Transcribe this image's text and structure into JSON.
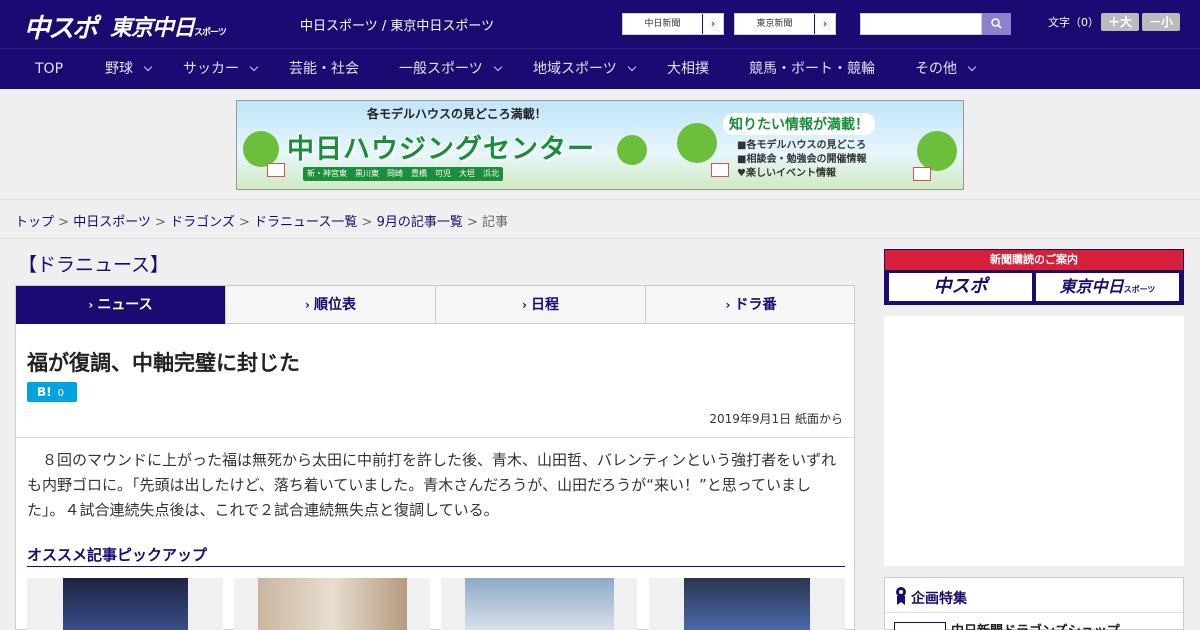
{
  "header": {
    "logo_chuspo": "中スポ",
    "logo_tokyo": "東京中日",
    "logo_tokyo_sub": "スポーツ",
    "site_title": "中日スポーツ / 東京中日スポーツ",
    "link_chunichi": "中日新聞",
    "link_tokyo": "東京新聞",
    "font_label": "文字（0）",
    "font_larger": "＋大",
    "font_smaller": "－小"
  },
  "nav": {
    "items": [
      "TOP",
      "野球",
      "サッカー",
      "芸能・社会",
      "一般スポーツ",
      "地域スポーツ",
      "大相撲",
      "競馬・ボート・競輪",
      "その他"
    ]
  },
  "banner": {
    "line1": "各モデルハウスの見どころ満載！",
    "line2": "中日ハウジングセンター",
    "line3": "知りたい情報が満載！",
    "line4a": "■各モデルハウスの見どころ",
    "line4b": "■相談会・勉強会の開催情報",
    "line4c": "♥楽しいイベント情報",
    "towns": "新・神宮東　黒川東　岡崎　豊橋　可児　大垣　浜北"
  },
  "breadcrumb": {
    "items": [
      "トップ",
      "中日スポーツ",
      "ドラゴンズ",
      "ドラニュース一覧",
      "9月の記事一覧"
    ],
    "current": "記事",
    "sep": " > "
  },
  "main": {
    "section_title": "【ドラニュース】",
    "tabs": [
      "ニュース",
      "順位表",
      "日程",
      "ドラ番"
    ],
    "headline": "福が復調、中軸完璧に封じた",
    "hatena_label": "B!",
    "hatena_count": "0",
    "pubdate": "2019年9月1日 紙面から",
    "body": "　８回のマウンドに上がった福は無死から太田に中前打を許した後、青木、山田哲、バレンティンという強打者をいずれも内野ゴロに。「先頭は出したけど、落ち着いていました。青木さんだろうが、山田だろうが“来い！”と思っていました」。４試合連続失点後は、これで２試合連続無失点と復調している。",
    "pickup_title": "オススメ記事ピックアップ"
  },
  "sidebar": {
    "subscription_head": "新聞購読のご案内",
    "sub_logo1": "中スポ",
    "sub_logo2": "東京中日",
    "sub_logo2_small": "スポーツ",
    "kikaku_title": "企画特集",
    "kikaku_item": "中日新聞ドラゴンズショップ"
  },
  "colors": {
    "brand_navy": "#1b0a72",
    "accent_red": "#d61f38",
    "hatena_blue": "#00a4de"
  },
  "icons": {
    "search": "search-icon",
    "chevron": "chevron-down-icon",
    "arrow": "chevron-right-icon",
    "ribbon": "ribbon-icon"
  }
}
